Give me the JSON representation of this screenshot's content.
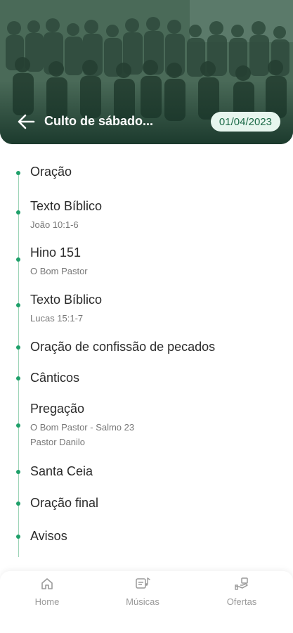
{
  "header": {
    "title": "Culto de sábado...",
    "date": "01/04/2023"
  },
  "timeline": {
    "items": [
      {
        "title": "Oração"
      },
      {
        "title": "Texto Bíblico",
        "sub": "João 10:1-6"
      },
      {
        "title": "Hino 151",
        "sub": "O Bom Pastor"
      },
      {
        "title": "Texto Bíblico",
        "sub": "Lucas 15:1-7"
      },
      {
        "title": "Oração de confissão de pecados"
      },
      {
        "title": "Cânticos"
      },
      {
        "title": "Pregação",
        "sub": "O Bom Pastor - Salmo 23",
        "sub2": "Pastor Danilo"
      },
      {
        "title": "Santa Ceia"
      },
      {
        "title": "Oração final"
      },
      {
        "title": "Avisos"
      }
    ]
  },
  "nav": {
    "home": "Home",
    "musicas": "Músicas",
    "ofertas": "Ofertas"
  },
  "colors": {
    "accent": "#1fa06a",
    "badge_bg": "#e7f6ee",
    "badge_text": "#1d6b48"
  },
  "icons": {
    "back": "arrow-left-icon",
    "home": "home-icon",
    "musicas": "music-note-icon",
    "ofertas": "offering-icon"
  }
}
